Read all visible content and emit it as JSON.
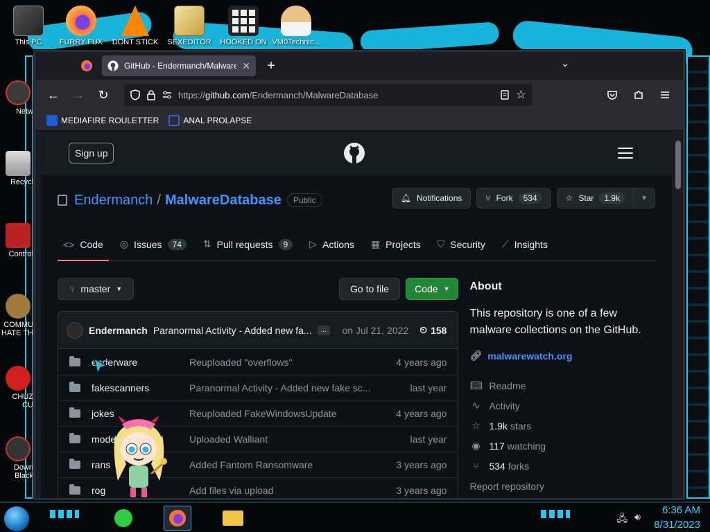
{
  "desktop": {
    "top_icons": [
      {
        "label": "This PC",
        "icon": "computer-icon",
        "color": "#9aa0a6"
      },
      {
        "label": "FURRY FUX",
        "icon": "firefox-icon",
        "color": "#ff7139"
      },
      {
        "label": "DONT STICK",
        "icon": "vlc-cone-icon",
        "color": "#ff8800"
      },
      {
        "label": "SEXEDITOR",
        "icon": "hex-editor-icon",
        "color": "#c8a03c"
      },
      {
        "label": "HOOKED ON",
        "icon": "maze-icon",
        "color": "#cfcfcf"
      },
      {
        "label": "VM0Technic...",
        "icon": "doctor-icon",
        "color": "#e8c48a"
      }
    ],
    "side_icons": [
      {
        "label": "Netw",
        "icon": "network-icon"
      },
      {
        "label": "Recycl",
        "icon": "recycle-bin-icon"
      },
      {
        "label": "Control",
        "icon": "control-panel-icon"
      },
      {
        "label": "COMMU HATE TH",
        "icon": "money-bag-icon"
      },
      {
        "label": "CHUZ CU",
        "icon": "red-creature-icon"
      },
      {
        "label": "Down Black",
        "icon": "download-icon"
      }
    ]
  },
  "browser": {
    "tab_title": "GitHub - Endermanch/Malware",
    "url_prefix": "https://",
    "url_host": "github.com",
    "url_path": "/Endermanch/MalwareDatabase",
    "bookmarks": [
      {
        "label": "MEDIAFIRE ROULETTER",
        "icon": "mediafire-icon",
        "color": "#1e5bd8"
      },
      {
        "label": "ANAL PROLAPSE",
        "icon": "bookmark-blue-icon",
        "color": "#3a5bd8"
      }
    ]
  },
  "github": {
    "signup": "Sign up",
    "owner": "Endermanch",
    "slash": "/",
    "repo": "MalwareDatabase",
    "visibility": "Public",
    "notifications": "Notifications",
    "fork_label": "Fork",
    "fork_count": "534",
    "star_label": "Star",
    "star_count": "1.9k",
    "nav": [
      {
        "label": "Code",
        "icon": "<>",
        "count": ""
      },
      {
        "label": "Issues",
        "icon": "◎",
        "count": "74"
      },
      {
        "label": "Pull requests",
        "icon": "⇅",
        "count": "9"
      },
      {
        "label": "Actions",
        "icon": "▷",
        "count": ""
      },
      {
        "label": "Projects",
        "icon": "▦",
        "count": ""
      },
      {
        "label": "Security",
        "icon": "⛉",
        "count": ""
      },
      {
        "label": "Insights",
        "icon": "⟋",
        "count": ""
      }
    ],
    "branch": "master",
    "go_to_file": "Go to file",
    "code_button": "Code",
    "commit": {
      "author": "Endermanch",
      "message": "Paranormal Activity - Added new fa...",
      "ellipsis": "...",
      "date": "on Jul 21, 2022",
      "count": "158"
    },
    "files": [
      {
        "name": "enderware",
        "message": "Reuploaded \"overflows\"",
        "date": "4 years ago"
      },
      {
        "name": "fakescanners",
        "message": "Paranormal Activity - Added new fake sc...",
        "date": "last year"
      },
      {
        "name": "jokes",
        "message": "Reuploaded FakeWindowsUpdate",
        "date": "4 years ago"
      },
      {
        "name": "mode",
        "message": "Uploaded Walliant",
        "date": "last year"
      },
      {
        "name": "rans",
        "message": "Added Fantom Ransomware",
        "date": "3 years ago"
      },
      {
        "name": "rog",
        "message": "Add files via upload",
        "date": "3 years ago"
      }
    ],
    "about": {
      "heading": "About",
      "description": "This repository is one of a few malware collections on the GitHub.",
      "link": "malwarewatch.org",
      "readme": "Readme",
      "activity": "Activity",
      "stars_value": "1.9k",
      "stars_label": "stars",
      "watching_value": "117",
      "watching_label": "watching",
      "forks_value": "534",
      "forks_label": "forks",
      "report": "Report repository"
    }
  },
  "taskbar": {
    "apps": [
      {
        "name": "notes-app",
        "color": "#2ecc40"
      },
      {
        "name": "firefox",
        "color": "#ff7139"
      },
      {
        "name": "file-explorer",
        "color": "#f3c544"
      }
    ],
    "time": "6:36 AM",
    "date": "8/31/2023"
  },
  "colors": {
    "wallpaper_accent": "#19b4dc",
    "github_bg": "#0d1117",
    "link_blue": "#4493f8",
    "green_button": "#238636",
    "active_tab_underline": "#f78166"
  }
}
